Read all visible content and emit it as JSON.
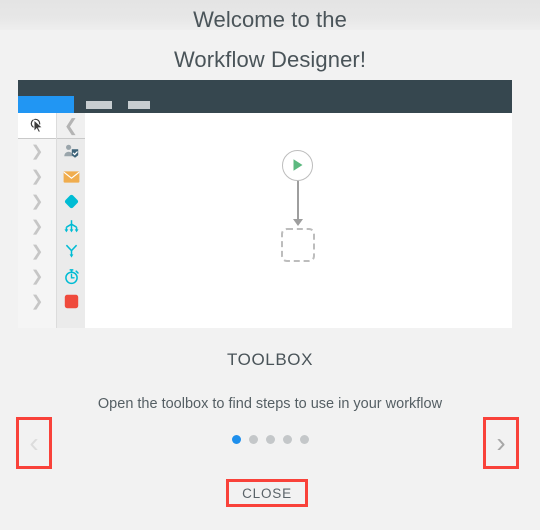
{
  "tour": {
    "title_line1": "Welcome to the",
    "title_line2": "Workflow Designer!",
    "step_title": "TOOLBOX",
    "step_description": "Open the toolbox to find steps to use in your workflow",
    "close_label": "CLOSE",
    "prev_glyph": "‹",
    "next_glyph": "›",
    "dots": [
      {
        "active": true
      },
      {
        "active": false
      },
      {
        "active": false
      },
      {
        "active": false
      },
      {
        "active": false
      }
    ],
    "colors": {
      "highlight_border": "#f9423a",
      "dot_active": "#1e8fec",
      "dot_inactive": "#c4c7c9",
      "heading_text": "#4a5459"
    }
  },
  "app_screenshot": {
    "topbar": {
      "background": "#36474f",
      "active_tab_color": "#2196f3",
      "ghost_tabs": 2
    },
    "sidebar": {
      "header_icon": "cursor-pointer-icon",
      "collapse_icon": "chevron-left-icon",
      "rows": [
        {
          "expander": "chevron-right-icon",
          "icon": "user-approval-icon",
          "color": "#2f6f8f"
        },
        {
          "expander": "chevron-right-icon",
          "icon": "envelope-icon",
          "color": "#f0ad4e"
        },
        {
          "expander": "chevron-right-icon",
          "icon": "decision-diamond-icon",
          "color": "#00bcd4"
        },
        {
          "expander": "chevron-right-icon",
          "icon": "parallel-split-icon",
          "color": "#00bcd4"
        },
        {
          "expander": "chevron-right-icon",
          "icon": "merge-join-icon",
          "color": "#00bcd4"
        },
        {
          "expander": "chevron-right-icon",
          "icon": "timer-icon",
          "color": "#00bcd4"
        },
        {
          "expander": "chevron-right-icon",
          "icon": "stop-square-icon",
          "color": "#ef4a3c"
        }
      ]
    },
    "canvas": {
      "start_node_icon": "play-triangle-icon",
      "start_node_color": "#5cb97f",
      "drop_target_icon": "dashed-placeholder-icon",
      "connector_icon": "arrow-down-connector-icon"
    }
  }
}
